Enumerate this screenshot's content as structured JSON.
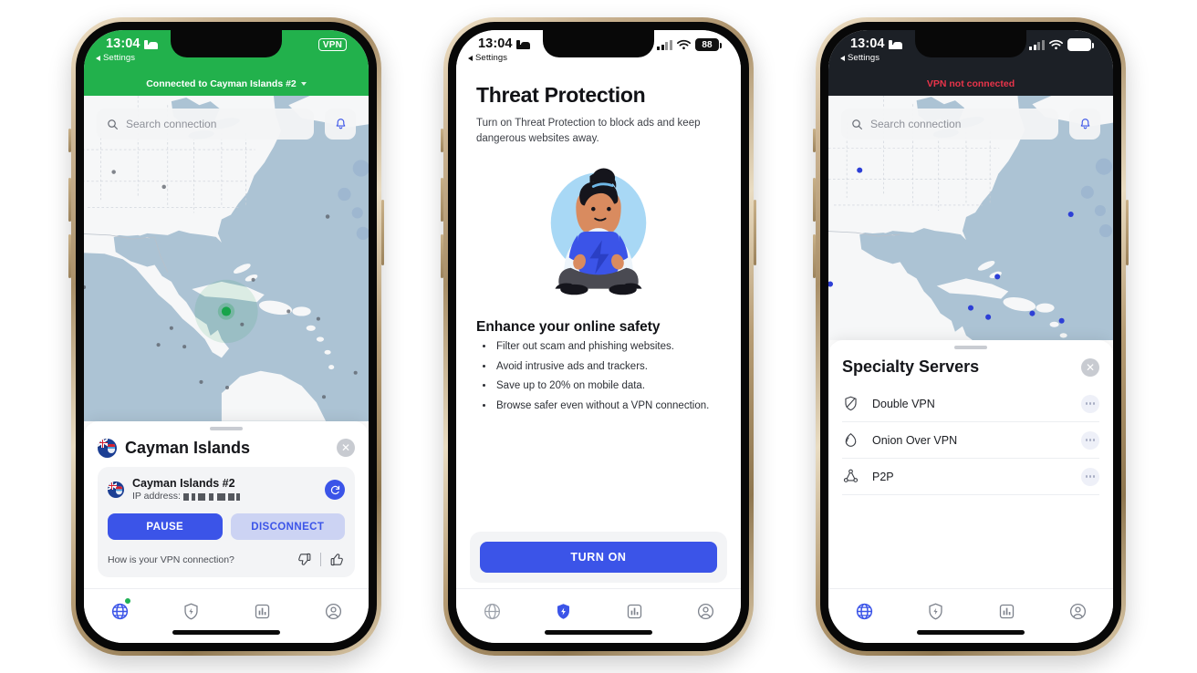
{
  "phones": [
    {
      "id": "phone-connected",
      "status_bar": {
        "time": "13:04",
        "bed_icon": "bed-icon",
        "vpn_badge": "VPN",
        "back_label": "Settings",
        "theme": "green"
      },
      "connection_banner": {
        "text": "Connected to Cayman Islands #2",
        "chevron": "chevron-down-icon",
        "bg_color": "#22b14c"
      },
      "search": {
        "placeholder": "Search connection",
        "icon": "search-icon",
        "bell_icon": "bell-icon"
      },
      "map": {
        "marker_color": "#17a44a",
        "marker_label": "Cayman Islands",
        "water_color": "#acc3d4",
        "land_color": "#f6f7f8"
      },
      "sheet": {
        "title": "Cayman Islands",
        "close_icon": "close-icon",
        "server": {
          "name": "Cayman Islands #2",
          "ip_label": "IP address:",
          "ip_value_masked": "•••",
          "refresh_icon": "refresh-icon"
        },
        "buttons": {
          "primary": "PAUSE",
          "secondary": "DISCONNECT"
        },
        "feedback": {
          "question": "How is your VPN connection?",
          "thumbs_down_icon": "thumbs-down-icon",
          "thumbs_up_icon": "thumbs-up-icon"
        }
      },
      "tabs": [
        {
          "name": "globe",
          "icon": "globe-icon",
          "active": true,
          "badge": true
        },
        {
          "name": "threat-protection",
          "icon": "shield-bolt-icon",
          "active": false,
          "badge": false
        },
        {
          "name": "stats",
          "icon": "bar-chart-icon",
          "active": false,
          "badge": false
        },
        {
          "name": "profile",
          "icon": "user-icon",
          "active": false,
          "badge": false
        }
      ]
    },
    {
      "id": "phone-threat-protection",
      "status_bar": {
        "time": "13:04",
        "bed_icon": "bed-icon",
        "signal_icon": "cellular-signal-icon",
        "wifi_icon": "wifi-icon",
        "battery": "88",
        "back_label": "Settings",
        "theme": "light"
      },
      "content": {
        "title": "Threat Protection",
        "subtitle": "Turn on Threat Protection to block ads and keep dangerous websites away.",
        "illustration": "person-holding-shield-illustration",
        "section_heading": "Enhance your online safety",
        "bullets": [
          "Filter out scam and phishing websites.",
          "Avoid intrusive ads and trackers.",
          "Save up to 20% on mobile data.",
          "Browse safer even without a VPN connection."
        ],
        "cta_label": "TURN ON"
      },
      "tabs": [
        {
          "name": "globe",
          "icon": "globe-icon",
          "active": false,
          "badge": false
        },
        {
          "name": "threat-protection",
          "icon": "shield-bolt-icon",
          "active": true,
          "badge": false
        },
        {
          "name": "stats",
          "icon": "bar-chart-icon",
          "active": false,
          "badge": false
        },
        {
          "name": "profile",
          "icon": "user-icon",
          "active": false,
          "badge": false
        }
      ]
    },
    {
      "id": "phone-specialty-servers",
      "status_bar": {
        "time": "13:04",
        "bed_icon": "bed-icon",
        "signal_icon": "cellular-signal-icon",
        "wifi_icon": "wifi-icon",
        "battery": "88",
        "back_label": "Settings",
        "theme": "dark"
      },
      "connection_banner": {
        "text": "VPN not connected",
        "text_color": "#e8344a",
        "bg_color": "#1c2026"
      },
      "search": {
        "placeholder": "Search connection",
        "icon": "search-icon",
        "bell_icon": "bell-icon"
      },
      "map": {
        "marker_color": "#2d3fd6",
        "water_color": "#acc3d4",
        "land_color": "#f6f7f8"
      },
      "sheet": {
        "title": "Specialty Servers",
        "close_icon": "close-icon",
        "rows": [
          {
            "label": "Double VPN",
            "icon": "double-shield-icon",
            "more_icon": "more-icon"
          },
          {
            "label": "Onion Over VPN",
            "icon": "onion-icon",
            "more_icon": "more-icon"
          },
          {
            "label": "P2P",
            "icon": "p2p-icon",
            "more_icon": "more-icon"
          }
        ]
      },
      "tabs": [
        {
          "name": "globe",
          "icon": "globe-icon",
          "active": true,
          "badge": false
        },
        {
          "name": "threat-protection",
          "icon": "shield-bolt-icon",
          "active": false,
          "badge": false
        },
        {
          "name": "stats",
          "icon": "bar-chart-icon",
          "active": false,
          "badge": false
        },
        {
          "name": "profile",
          "icon": "user-icon",
          "active": false,
          "badge": false
        }
      ]
    }
  ],
  "colors": {
    "accent_blue": "#3b54e8",
    "connected_green": "#22b14c",
    "alert_red": "#e8344a",
    "map_water": "#acc3d4",
    "map_land": "#f6f7f8"
  }
}
